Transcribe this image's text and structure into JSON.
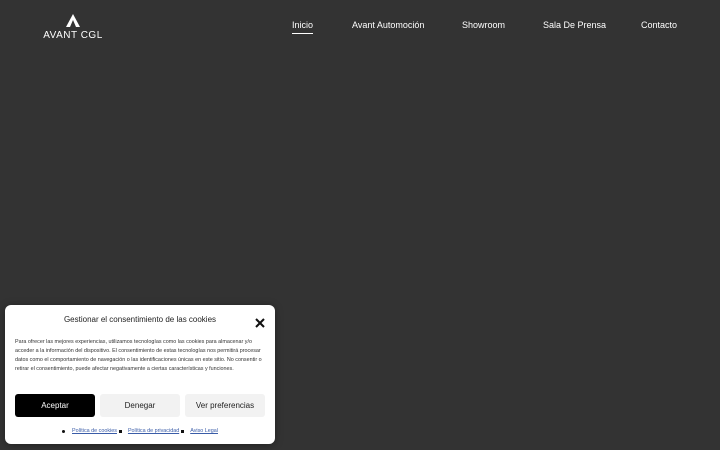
{
  "brand": {
    "name": "AVANT CGL",
    "logo_icon": "triangle-logo-icon"
  },
  "nav": {
    "items": [
      {
        "label": "Inicio",
        "active": true
      },
      {
        "label": "Avant Automoción",
        "active": false
      },
      {
        "label": "Showroom",
        "active": false
      },
      {
        "label": "Sala De Prensa",
        "active": false
      },
      {
        "label": "Contacto",
        "active": false
      }
    ]
  },
  "cookie_banner": {
    "title": "Gestionar el consentimiento de las cookies",
    "close_icon": "close-icon",
    "body": "Para ofrecer las mejores experiencias, utilizamos tecnologías como las cookies para almacenar y/o acceder a la información del dispositivo. El consentimiento de estas tecnologías nos permitirá procesar datos como el comportamiento de navegación o las identificaciones únicas en este sitio. No consentir o retirar el consentimiento, puede afectar negativamente a ciertas características y funciones.",
    "accept_label": "Aceptar",
    "deny_label": "Denegar",
    "prefs_label": "Ver preferencias",
    "links": {
      "cookies": "Política de cookies",
      "privacy": "Política de privacidad",
      "legal": "Aviso Legal"
    }
  },
  "colors": {
    "background": "#333333",
    "panel": "#ffffff",
    "accept_button": "#000000",
    "secondary_button": "#f2f2f2",
    "link": "#3a5ca8"
  }
}
